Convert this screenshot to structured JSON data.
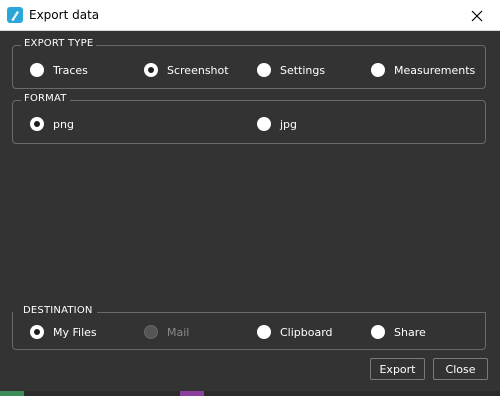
{
  "window": {
    "title": "Export data",
    "app_icon": "app-logo-icon",
    "close_icon": "close-icon"
  },
  "export_type": {
    "label": "EXPORT TYPE",
    "options": [
      {
        "label": "Traces",
        "checked": false
      },
      {
        "label": "Screenshot",
        "checked": true
      },
      {
        "label": "Settings",
        "checked": false
      },
      {
        "label": "Measurements",
        "checked": false
      }
    ]
  },
  "format": {
    "label": "FORMAT",
    "options": [
      {
        "label": "png",
        "checked": true
      },
      {
        "label": "jpg",
        "checked": false
      }
    ]
  },
  "destination": {
    "label": "DESTINATION",
    "options": [
      {
        "label": "My Files",
        "checked": true,
        "disabled": false
      },
      {
        "label": "Mail",
        "checked": false,
        "disabled": true
      },
      {
        "label": "Clipboard",
        "checked": false,
        "disabled": false
      },
      {
        "label": "Share",
        "checked": false,
        "disabled": false
      }
    ]
  },
  "buttons": {
    "export": "Export",
    "close": "Close"
  },
  "colors": {
    "background": "#333333",
    "border": "#6a6a6a",
    "accent": "#2aa7d8"
  }
}
